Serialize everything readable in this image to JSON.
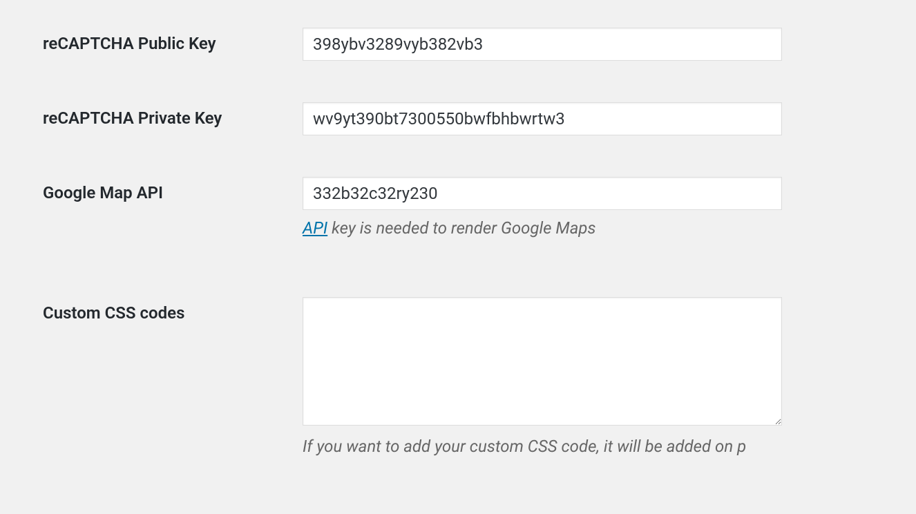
{
  "form": {
    "recaptcha_public": {
      "label": "reCAPTCHA Public Key",
      "value": "398ybv3289vyb382vb3"
    },
    "recaptcha_private": {
      "label": "reCAPTCHA Private Key",
      "value": "wv9yt390bt7300550bwfbhbwrtw3"
    },
    "google_map_api": {
      "label": "Google Map API",
      "value": "332b32c32ry230",
      "help_link_text": "API",
      "help_text": " key is needed to render Google Maps"
    },
    "custom_css": {
      "label": "Custom CSS codes",
      "value": "",
      "help_text": "If you want to add your custom CSS code, it will be added on p"
    }
  }
}
